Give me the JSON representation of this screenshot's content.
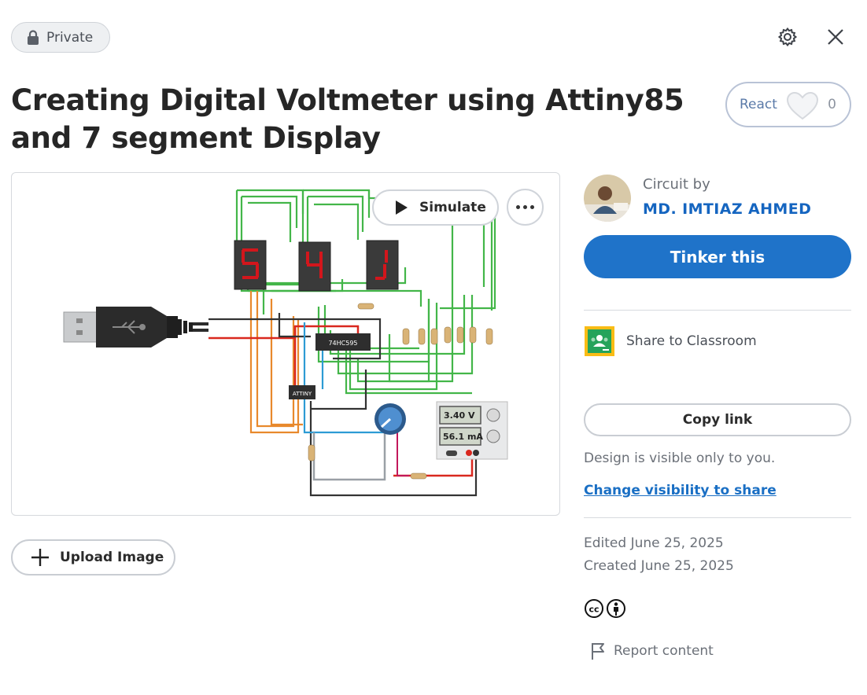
{
  "privacy": {
    "label": "Private"
  },
  "icons": {
    "lock": "lock-icon",
    "settings": "gear-icon",
    "close": "close-icon",
    "heart": "heart-icon",
    "play": "play-icon",
    "more": "more-icon",
    "plus": "plus-icon",
    "classroom": "google-classroom-icon",
    "cc": "creative-commons-icon",
    "by": "attribution-icon",
    "flag": "flag-icon"
  },
  "design": {
    "title": "Creating Digital Voltmeter using Attiny85 and 7 segment Display"
  },
  "react": {
    "label": "React",
    "count": "0"
  },
  "canvas": {
    "simulate_label": "Simulate",
    "displays": [
      "5",
      "4",
      "1"
    ],
    "ic_shift_register": "74HC595",
    "ic_mcu": "ATTINY",
    "supply_voltage": "3.40 V",
    "supply_current": "56.1 mA"
  },
  "upload": {
    "label": "Upload Image"
  },
  "author": {
    "prefix": "Circuit by",
    "name": "MD. IMTIAZ AHMED"
  },
  "actions": {
    "tinker_label": "Tinker this",
    "classroom_label": "Share to Classroom",
    "copy_link_label": "Copy link",
    "visibility_note": "Design is visible only to you.",
    "change_visibility_label": "Change visibility to share"
  },
  "meta": {
    "edited": "Edited June 25, 2025",
    "created": "Created June 25, 2025"
  },
  "report": {
    "label": "Report content"
  },
  "colors": {
    "accent": "#1f73c9",
    "link": "#1565c0",
    "wire_green": "#43b649",
    "wire_orange": "#e8892c",
    "wire_red": "#d9281f",
    "wire_blue": "#2d9bd4",
    "segment_red": "#d3161c"
  }
}
